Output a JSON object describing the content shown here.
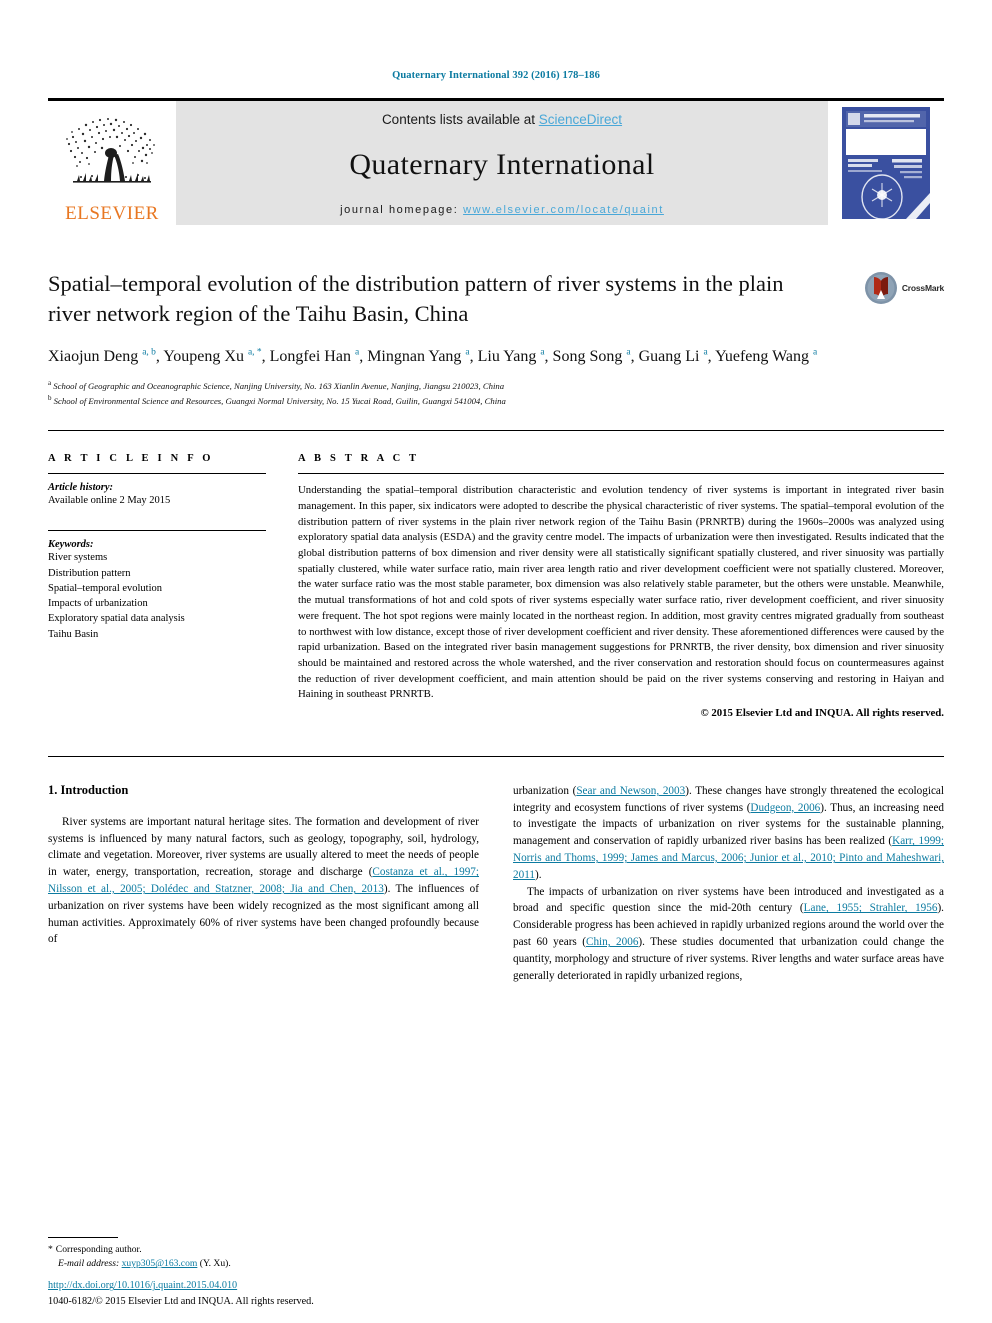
{
  "running_head": "Quaternary International 392 (2016) 178–186",
  "masthead": {
    "publisher_name": "ELSEVIER",
    "contents_prefix": "Contents lists available at ",
    "sciencedirect_link": "ScienceDirect",
    "journal_title": "Quaternary International",
    "homepage_label": "journal homepage: ",
    "homepage_url": "www.elsevier.com/locate/quaint",
    "cover_title": "QUATERNARY INTERNATIONAL"
  },
  "crossmark": {
    "label": "CrossMark"
  },
  "article": {
    "title": "Spatial–temporal evolution of the distribution pattern of river systems in the plain river network region of the Taihu Basin, China",
    "authors_html": "Xiaojun Deng <sup>a, b</sup>, Youpeng Xu <sup>a, *</sup>, Longfei Han <sup>a</sup>, Mingnan Yang <sup>a</sup>, Liu Yang <sup>a</sup>, Song Song <sup>a</sup>, Guang Li <sup>a</sup>, Yuefeng Wang <sup>a</sup>",
    "affiliation_a": "School of Geographic and Oceanographic Science, Nanjing University, No. 163 Xianlin Avenue, Nanjing, Jiangsu 210023, China",
    "affiliation_b": "School of Environmental Science and Resources, Guangxi Normal University, No. 15 Yucai Road, Guilin, Guangxi 541004, China"
  },
  "article_info": {
    "heading": "A R T I C L E   I N F O",
    "history_label": "Article history:",
    "history_value": "Available online 2 May 2015",
    "keywords_label": "Keywords:",
    "keywords": [
      "River systems",
      "Distribution pattern",
      "Spatial–temporal evolution",
      "Impacts of urbanization",
      "Exploratory spatial data analysis",
      "Taihu Basin"
    ]
  },
  "abstract": {
    "heading": "A B S T R A C T",
    "text": "Understanding the spatial–temporal distribution characteristic and evolution tendency of river systems is important in integrated river basin management. In this paper, six indicators were adopted to describe the physical characteristic of river systems. The spatial–temporal evolution of the distribution pattern of river systems in the plain river network region of the Taihu Basin (PRNRTB) during the 1960s–2000s was analyzed using exploratory spatial data analysis (ESDA) and the gravity centre model. The impacts of urbanization were then investigated. Results indicated that the global distribution patterns of box dimension and river density were all statistically significant spatially clustered, and river sinuosity was partially spatially clustered, while water surface ratio, main river area length ratio and river development coefficient were not spatially clustered. Moreover, the water surface ratio was the most stable parameter, box dimension was also relatively stable parameter, but the others were unstable. Meanwhile, the mutual transformations of hot and cold spots of river systems especially water surface ratio, river development coefficient, and river sinuosity were frequent. The hot spot regions were mainly located in the northeast region. In addition, most gravity centres migrated gradually from southeast to northwest with low distance, except those of river development coefficient and river density. These aforementioned differences were caused by the rapid urbanization. Based on the integrated river basin management suggestions for PRNRTB, the river density, box dimension and river sinuosity should be maintained and restored across the whole watershed, and the river conservation and restoration should focus on countermeasures against the reduction of river development coefficient, and main attention should be paid on the river systems conserving and restoring in Haiyan and Haining in southeast PRNRTB.",
    "copyright": "© 2015 Elsevier Ltd and INQUA. All rights reserved."
  },
  "introduction": {
    "section_title": "1. Introduction",
    "left_paragraph_1_pre": "River systems are important natural heritage sites. The formation and development of river systems is influenced by many natural factors, such as geology, topography, soil, hydrology, climate and vegetation. Moreover, river systems are usually altered to meet the needs of people in water, energy, transportation, recreation, storage and discharge (",
    "left_paragraph_1_ref1": "Costanza et al., 1997; Nilsson et al., 2005; Dolédec and Statzner, 2008; Jia and Chen, 2013",
    "left_paragraph_1_post": "). The influences of urbanization on river systems have been widely recognized as the most significant among all human activities. Approximately 60% of river systems have been changed profoundly because of",
    "right_paragraph_1_pre": "urbanization (",
    "right_paragraph_1_ref1": "Sear and Newson, 2003",
    "right_paragraph_1_mid1": "). These changes have strongly threatened the ecological integrity and ecosystem functions of river systems (",
    "right_paragraph_1_ref2": "Dudgeon, 2006",
    "right_paragraph_1_mid2": "). Thus, an increasing need to investigate the impacts of urbanization on river systems for the sustainable planning, management and conservation of rapidly urbanized river basins has been realized (",
    "right_paragraph_1_ref3": "Karr, 1999; Norris and Thoms, 1999; James and Marcus, 2006; Junior et al., 2010; Pinto and Maheshwari, 2011",
    "right_paragraph_1_post": ").",
    "right_paragraph_2_pre": "The impacts of urbanization on river systems have been introduced and investigated as a broad and specific question since the mid-20th century (",
    "right_paragraph_2_ref1": "Lane, 1955; Strahler, 1956",
    "right_paragraph_2_mid1": "). Considerable progress has been achieved in rapidly urbanized regions around the world over the past 60 years (",
    "right_paragraph_2_ref2": "Chin, 2006",
    "right_paragraph_2_post": "). These studies documented that urbanization could change the quantity, morphology and structure of river systems. River lengths and water surface areas have generally deteriorated in rapidly urbanized regions,"
  },
  "footnote": {
    "star": "*",
    "corresponding": "Corresponding author.",
    "email_label": "E-mail address:",
    "email": "xuyp305@163.com",
    "email_suffix": "(Y. Xu)."
  },
  "footer": {
    "doi": "http://dx.doi.org/10.1016/j.quaint.2015.04.010",
    "issn_line": "1040-6182/© 2015 Elsevier Ltd and INQUA. All rights reserved."
  },
  "colors": {
    "link_teal": "#0c7ba1",
    "sciencedirect_blue": "#4aa8d8",
    "elsevier_orange": "#e87722",
    "banner_gray": "#e3e3e3",
    "cover_blue": "#3a50a0"
  }
}
